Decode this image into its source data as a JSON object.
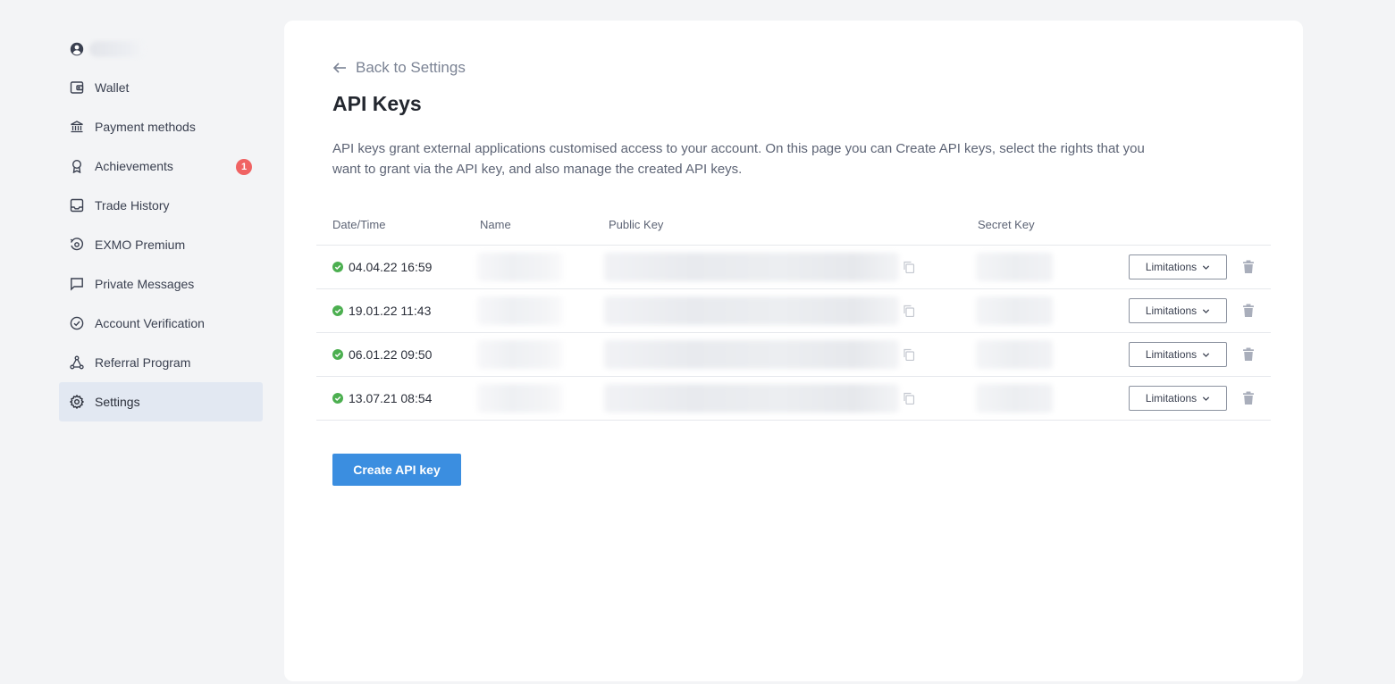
{
  "sidebar": {
    "items": [
      {
        "id": "wallet",
        "label": "Wallet",
        "icon": "wallet-icon"
      },
      {
        "id": "payment-methods",
        "label": "Payment methods",
        "icon": "bank-icon"
      },
      {
        "id": "achievements",
        "label": "Achievements",
        "icon": "award-icon",
        "badge": "1"
      },
      {
        "id": "trade-history",
        "label": "Trade History",
        "icon": "tray-icon"
      },
      {
        "id": "exmo-premium",
        "label": "EXMO Premium",
        "icon": "premium-icon"
      },
      {
        "id": "private-messages",
        "label": "Private Messages",
        "icon": "message-icon"
      },
      {
        "id": "account-verification",
        "label": "Account Verification",
        "icon": "check-circle-icon"
      },
      {
        "id": "referral-program",
        "label": "Referral Program",
        "icon": "network-icon"
      },
      {
        "id": "settings",
        "label": "Settings",
        "icon": "gear-icon",
        "active": true
      }
    ]
  },
  "main": {
    "back_label": "Back to Settings",
    "title": "API Keys",
    "description": "API keys grant external applications customised access to your account. On this page you can Create API keys, select the rights that you want to grant via the API key, and also manage the created API keys.",
    "table": {
      "headers": {
        "date": "Date/Time",
        "name": "Name",
        "public_key": "Public Key",
        "secret_key": "Secret Key"
      },
      "rows": [
        {
          "date": "04.04.22 16:59",
          "status": "active",
          "limitations": "Limitations"
        },
        {
          "date": "19.01.22 11:43",
          "status": "active",
          "limitations": "Limitations"
        },
        {
          "date": "06.01.22 09:50",
          "status": "active",
          "limitations": "Limitations"
        },
        {
          "date": "13.07.21 08:54",
          "status": "active",
          "limitations": "Limitations"
        }
      ]
    },
    "create_label": "Create API key"
  },
  "colors": {
    "accent": "#3b8ee0",
    "status_active": "#4caf50",
    "badge": "#f06363",
    "active_nav_bg": "#e2e8f2"
  }
}
